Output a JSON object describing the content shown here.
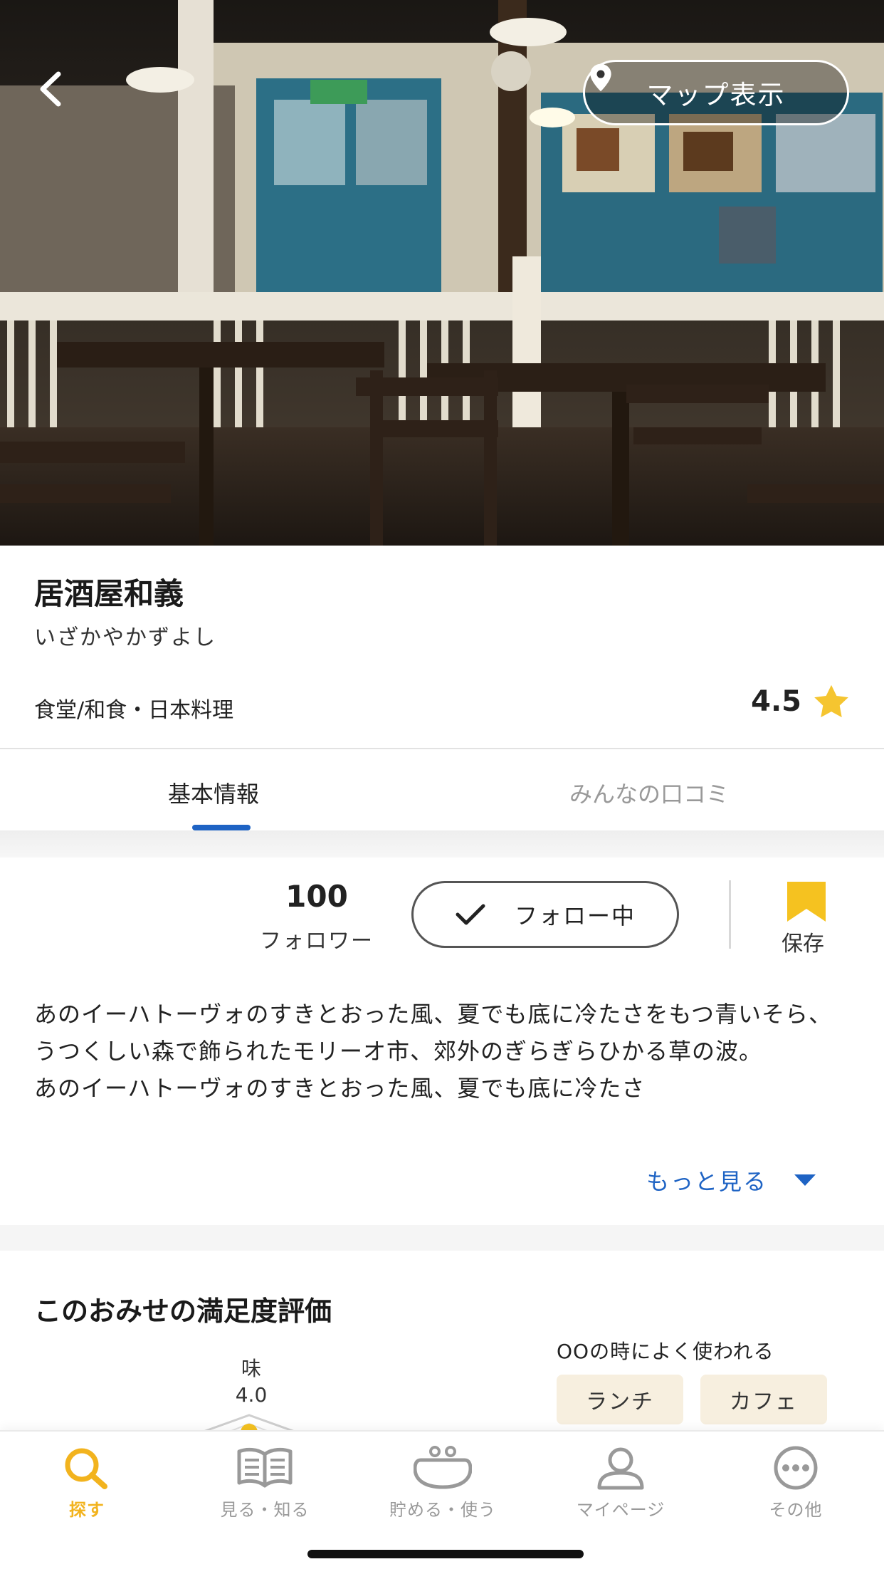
{
  "header": {
    "back_icon": "chevron-left-icon",
    "map_button": {
      "icon": "map-pin-icon",
      "label": "マップ表示"
    }
  },
  "shop": {
    "name": "居酒屋和義",
    "kana": "いざかやかずよし",
    "category": "食堂/和食・日本料理",
    "rating": "4.5",
    "rating_icon": "star-icon"
  },
  "tabs": [
    {
      "label": "基本情報",
      "active": true
    },
    {
      "label": "みんなの口コミ",
      "active": false
    }
  ],
  "follow": {
    "count": "100",
    "count_label": "フォロワー",
    "button_label": "フォロー中",
    "button_icon": "check-icon",
    "save_label": "保存",
    "save_icon": "bookmark-icon"
  },
  "description": {
    "lines": [
      "あのイーハトーヴォのすきとおった風、夏でも底に冷たさをもつ青いそら、うつくしい森で飾られたモリーオ市、郊外のぎらぎらひかる草の波。",
      "あのイーハトーヴォのすきとおった風、夏でも底に冷たさ"
    ],
    "more_label": "もっと見る",
    "more_icon": "caret-down-icon"
  },
  "satisfaction": {
    "title": "このおみせの満足度評価",
    "axis_label": "味",
    "axis_value": "4.0",
    "usage_title": "OOの時によく使われる",
    "chips": [
      "ランチ",
      "カフェ"
    ]
  },
  "bottom_nav": [
    {
      "label": "探す",
      "icon": "search-icon",
      "active": true
    },
    {
      "label": "見る・知る",
      "icon": "book-icon",
      "active": false
    },
    {
      "label": "貯める・使う",
      "icon": "purse-icon",
      "active": false
    },
    {
      "label": "マイページ",
      "icon": "person-icon",
      "active": false
    },
    {
      "label": "その他",
      "icon": "more-icon",
      "active": false
    }
  ],
  "colors": {
    "accent_blue": "#1e63c4",
    "accent_yellow": "#f2b31e",
    "chip_bg": "#f7efdf"
  }
}
